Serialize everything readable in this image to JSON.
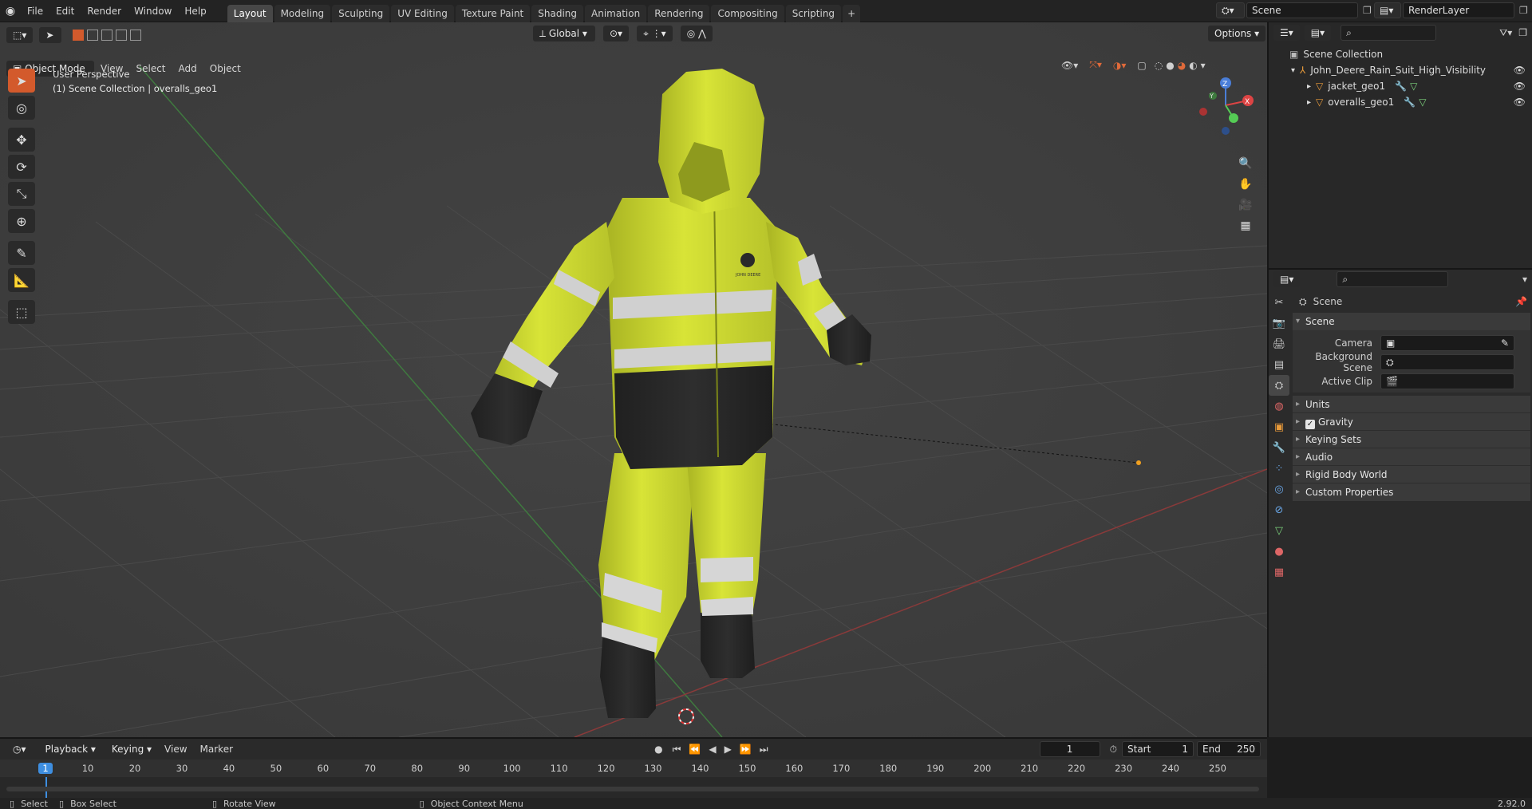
{
  "topbar": {
    "menus": [
      "File",
      "Edit",
      "Render",
      "Window",
      "Help"
    ],
    "workspaces": [
      "Layout",
      "Modeling",
      "Sculpting",
      "UV Editing",
      "Texture Paint",
      "Shading",
      "Animation",
      "Rendering",
      "Compositing",
      "Scripting"
    ],
    "active_workspace": "Layout",
    "add_tab": "+",
    "scene_name": "Scene",
    "view_layer": "RenderLayer"
  },
  "viewport": {
    "mode": "Object Mode",
    "menus": [
      "View",
      "Select",
      "Add",
      "Object"
    ],
    "orientation": "Global",
    "options": "Options",
    "overlay_title": "User Perspective",
    "overlay_subtitle": "(1) Scene Collection | overalls_geo1",
    "gizmo": {
      "x": "X",
      "y": "Y",
      "z": "Z"
    },
    "logo_text": "JOHN DEERE"
  },
  "outliner": {
    "root": "Scene Collection",
    "items": [
      {
        "name": "John_Deere_Rain_Suit_High_Visibility",
        "level": 1
      },
      {
        "name": "jacket_geo1",
        "level": 2
      },
      {
        "name": "overalls_geo1",
        "level": 2
      }
    ]
  },
  "properties": {
    "context": "Scene",
    "panel_open": "Scene",
    "fields": [
      {
        "label": "Camera",
        "value": ""
      },
      {
        "label": "Background Scene",
        "value": ""
      },
      {
        "label": "Active Clip",
        "value": ""
      }
    ],
    "panels": [
      "Units",
      "Gravity",
      "Keying Sets",
      "Audio",
      "Rigid Body World",
      "Custom Properties"
    ],
    "gravity_checked": true
  },
  "timeline": {
    "menus": [
      "Playback",
      "Keying",
      "View",
      "Marker"
    ],
    "current_frame": "1",
    "start_label": "Start",
    "start": "1",
    "end_label": "End",
    "end": "250",
    "ticks": [
      "1",
      "10",
      "20",
      "30",
      "40",
      "50",
      "60",
      "70",
      "80",
      "90",
      "100",
      "110",
      "120",
      "130",
      "140",
      "150",
      "160",
      "170",
      "180",
      "190",
      "200",
      "210",
      "220",
      "230",
      "240",
      "250"
    ]
  },
  "statusbar": {
    "select": "Select",
    "box_select": "Box Select",
    "rotate": "Rotate View",
    "context_menu": "Object Context Menu",
    "version": "2.92.0"
  },
  "colors": {
    "accent": "#d35a2c",
    "suit_yellow": "#d4e030",
    "suit_black": "#2a2a2a",
    "reflective": "#c8c8c8"
  }
}
